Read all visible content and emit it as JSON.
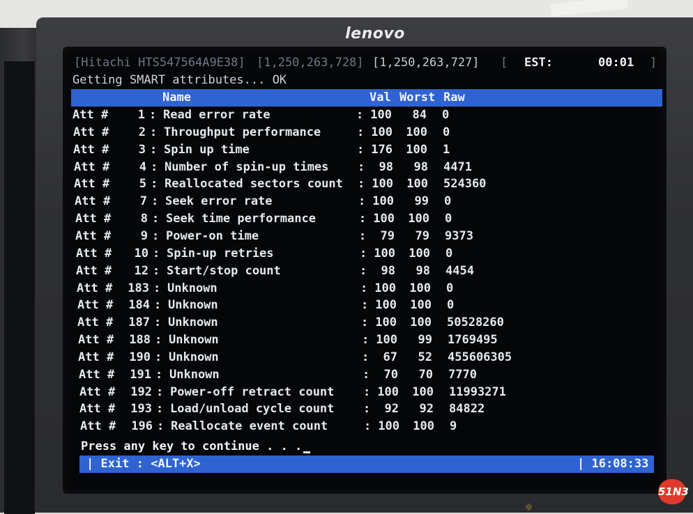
{
  "monitor": {
    "brand": "lenovo"
  },
  "topbar": {
    "device": "[Hitachi HTS547564A9E38]",
    "range1": "[1,250,263,728]",
    "range2": "[1,250,263,727]",
    "bracket_open": "[",
    "est_label": "EST:",
    "est_value": "00:01",
    "bracket_close": "]"
  },
  "status": {
    "message": "Getting SMART attributes... OK"
  },
  "table": {
    "headers": {
      "name": "Name",
      "val": "Val",
      "worst": "Worst",
      "raw": "Raw"
    },
    "rows": [
      {
        "prefix": "Att #",
        "id": "1",
        "name": "Read error rate",
        "val": "100",
        "worst": "84",
        "raw": "0"
      },
      {
        "prefix": "Att #",
        "id": "2",
        "name": "Throughput performance",
        "val": "100",
        "worst": "100",
        "raw": "0"
      },
      {
        "prefix": "Att #",
        "id": "3",
        "name": "Spin up time",
        "val": "176",
        "worst": "100",
        "raw": "1"
      },
      {
        "prefix": "Att #",
        "id": "4",
        "name": "Number of spin-up times",
        "val": "98",
        "worst": "98",
        "raw": "4471"
      },
      {
        "prefix": "Att #",
        "id": "5",
        "name": "Reallocated sectors count",
        "val": "100",
        "worst": "100",
        "raw": "524360"
      },
      {
        "prefix": "Att #",
        "id": "7",
        "name": "Seek error rate",
        "val": "100",
        "worst": "99",
        "raw": "0"
      },
      {
        "prefix": "Att #",
        "id": "8",
        "name": "Seek time performance",
        "val": "100",
        "worst": "100",
        "raw": "0"
      },
      {
        "prefix": "Att #",
        "id": "9",
        "name": "Power-on time",
        "val": "79",
        "worst": "79",
        "raw": "9373"
      },
      {
        "prefix": "Att #",
        "id": "10",
        "name": "Spin-up retries",
        "val": "100",
        "worst": "100",
        "raw": "0"
      },
      {
        "prefix": "Att #",
        "id": "12",
        "name": "Start/stop count",
        "val": "98",
        "worst": "98",
        "raw": "4454"
      },
      {
        "prefix": "Att #",
        "id": "183",
        "name": "Unknown",
        "val": "100",
        "worst": "100",
        "raw": "0"
      },
      {
        "prefix": "Att #",
        "id": "184",
        "name": "Unknown",
        "val": "100",
        "worst": "100",
        "raw": "0"
      },
      {
        "prefix": "Att #",
        "id": "187",
        "name": "Unknown",
        "val": "100",
        "worst": "100",
        "raw": "50528260"
      },
      {
        "prefix": "Att #",
        "id": "188",
        "name": "Unknown",
        "val": "100",
        "worst": "99",
        "raw": "1769495"
      },
      {
        "prefix": "Att #",
        "id": "190",
        "name": "Unknown",
        "val": "67",
        "worst": "52",
        "raw": "455606305"
      },
      {
        "prefix": "Att #",
        "id": "191",
        "name": "Unknown",
        "val": "70",
        "worst": "70",
        "raw": "7770"
      },
      {
        "prefix": "Att #",
        "id": "192",
        "name": "Power-off retract count",
        "val": "100",
        "worst": "100",
        "raw": "11993271"
      },
      {
        "prefix": "Att #",
        "id": "193",
        "name": "Load/unload cycle count",
        "val": "92",
        "worst": "92",
        "raw": "84822"
      },
      {
        "prefix": "Att #",
        "id": "196",
        "name": "Reallocate event count",
        "val": "100",
        "worst": "100",
        "raw": "9"
      }
    ]
  },
  "prompt": {
    "text": "Press any key to continue . . ."
  },
  "footer": {
    "exit_label": "| Exit : <ALT+X>",
    "clock": "| 16:08:33"
  },
  "watermark": {
    "text": "51N3"
  },
  "colors": {
    "bar": "#2f63d1",
    "screen": "#050607",
    "bezel": "#2f3033"
  },
  "icons": {
    "sun": "brightness-icon"
  }
}
